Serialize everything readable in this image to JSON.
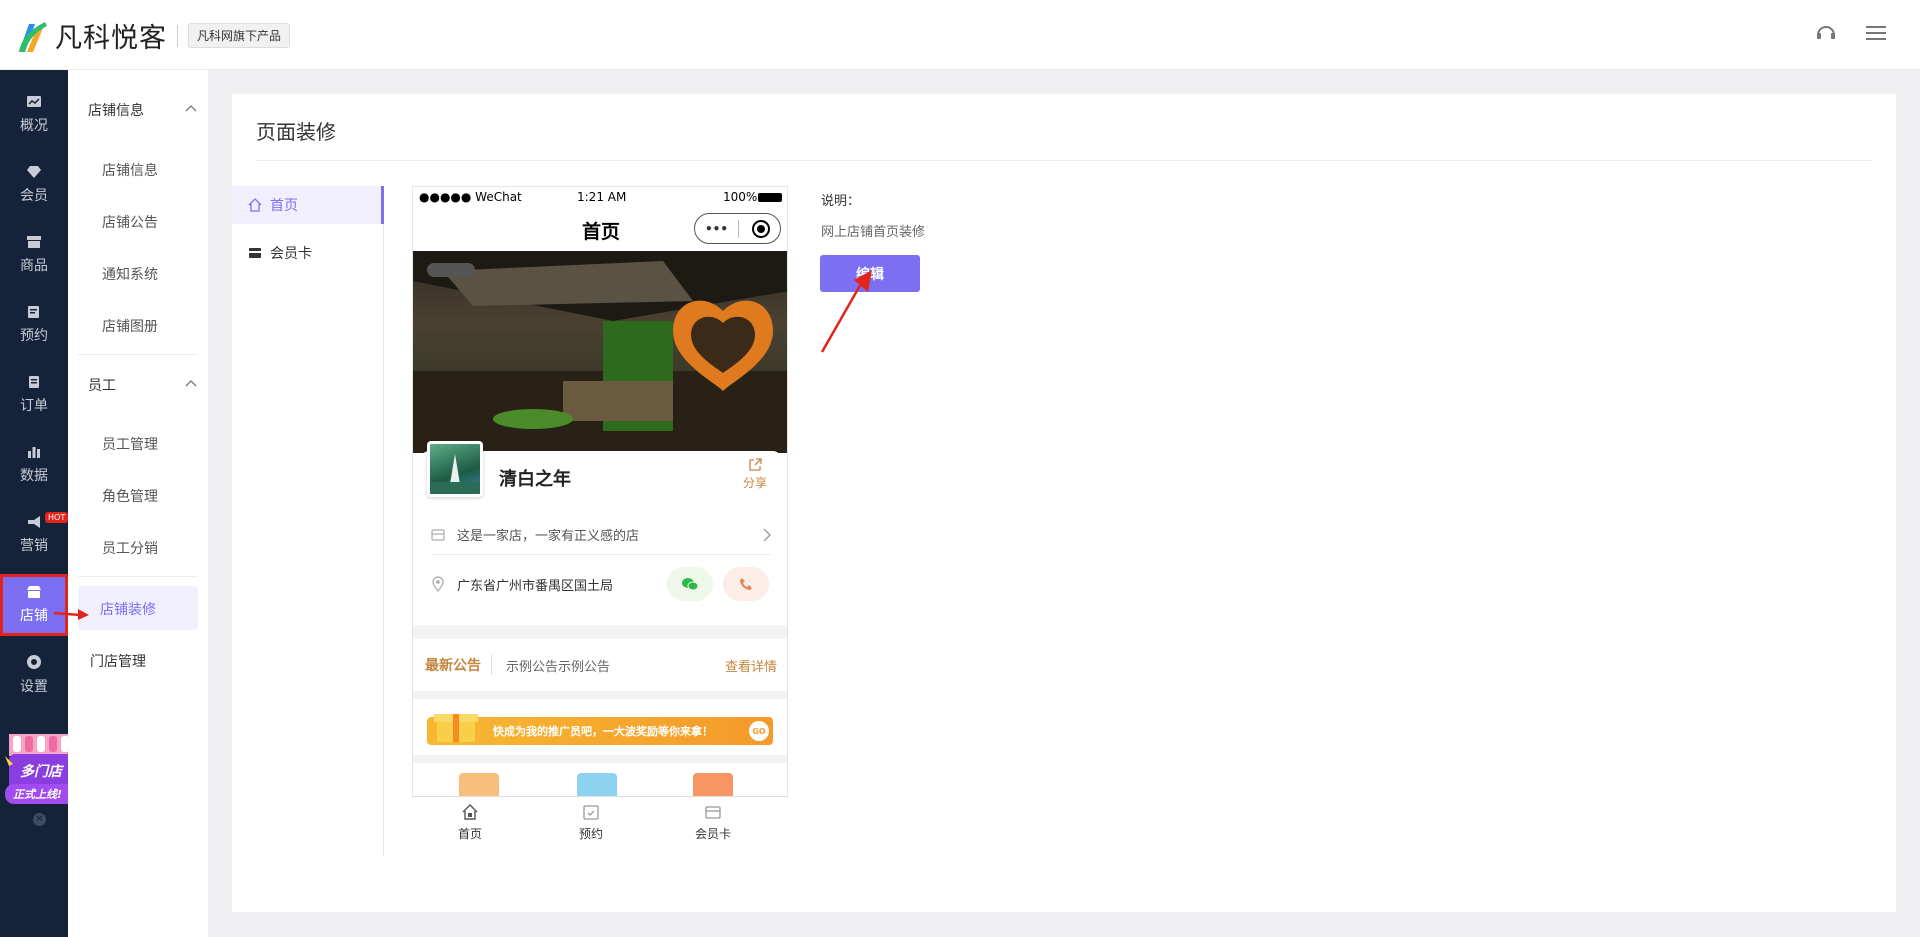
{
  "header": {
    "logo_text": "凡科悦客",
    "badge": "凡科网旗下产品",
    "icons": [
      "headset-icon",
      "menu-icon"
    ]
  },
  "nav": {
    "items": [
      {
        "label": "概况",
        "icon": "chart-icon"
      },
      {
        "label": "会员",
        "icon": "diamond-icon"
      },
      {
        "label": "商品",
        "icon": "box-icon"
      },
      {
        "label": "预约",
        "icon": "calendar-icon"
      },
      {
        "label": "订单",
        "icon": "order-icon"
      },
      {
        "label": "数据",
        "icon": "bar-chart-icon"
      },
      {
        "label": "营销",
        "icon": "megaphone-icon",
        "badge": "HOT"
      },
      {
        "label": "店铺",
        "icon": "store-icon",
        "active": true
      },
      {
        "label": "设置",
        "icon": "settings-icon"
      }
    ],
    "promo": {
      "line1": "多门店",
      "line2": "正式上线!"
    }
  },
  "subnav": {
    "group1": "店铺信息",
    "group1_items": [
      "店铺信息",
      "店铺公告",
      "通知系统",
      "店铺图册"
    ],
    "group2": "员工",
    "group2_items": [
      "员工管理",
      "角色管理",
      "员工分销"
    ],
    "active": "店铺装修",
    "other": "门店管理"
  },
  "main": {
    "title": "页面装修",
    "page_nav": [
      "首页",
      "会员卡"
    ],
    "description_label": "说明：",
    "description_text": "网上店铺首页装修",
    "edit_button": "编辑"
  },
  "phone": {
    "carrier": "●●●●● WeChat",
    "time": "1:21 AM",
    "battery": "100%",
    "page_title": "首页",
    "capsule_dots": "•••",
    "store_name": "清白之年",
    "share": "分享",
    "intro": "这是一家店，一家有正义感的店",
    "address": "广东省广州市番禺区国土局",
    "notice_label": "最新公告",
    "notice_text": "示例公告示例公告",
    "notice_link": "查看详情",
    "promo_text": "快成为我的推广员吧，一大波奖励等你来拿！",
    "promo_go": "GO",
    "tabs": [
      "首页",
      "预约",
      "会员卡"
    ]
  },
  "colors": {
    "accent": "#7d6ff2",
    "nav_bg": "#15233a",
    "highlight_red": "#e2251c",
    "gold": "#c58640"
  }
}
